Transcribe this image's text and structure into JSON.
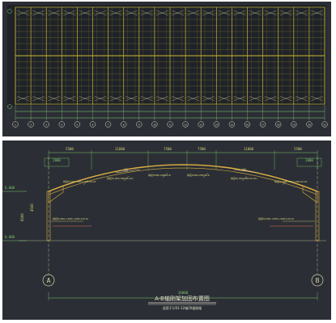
{
  "top_plan": {
    "bay_count": 20,
    "axis_count": 21,
    "grid_labels": [
      "1",
      "2",
      "3",
      "4",
      "5",
      "6",
      "7",
      "8",
      "9",
      "10",
      "11",
      "12",
      "13",
      "14",
      "15",
      "16",
      "17",
      "18",
      "19",
      "20",
      "21"
    ],
    "line_color": "#c8b432",
    "axis_color": "#8ad07a",
    "bg_color": "#1f2328"
  },
  "section": {
    "top_dimensions": [
      "5500",
      "11000",
      "7500",
      "7500",
      "11000",
      "5500"
    ],
    "span_dimension": "36000",
    "sub_dimensions": [
      "2000",
      "2000"
    ],
    "left_axis": "A",
    "right_axis": "B",
    "height_dims": [
      "6000",
      "4500"
    ],
    "elevations": [
      "6.000",
      "0.000"
    ],
    "slope_labels": [
      "10",
      "10"
    ],
    "beam_notes": [
      "焊接H(600~300)×300×8×10",
      "焊接H(300×300×8×10)",
      "焊接H300×200×6×8",
      "焊接H300×200×6×8",
      "焊接H(300×300×8×10)",
      "焊接H(600~300)×300×8×10"
    ],
    "column_notes": [
      "焊接H(600~1300)×400×10×16",
      "焊接H(600~1300)×400×10×16"
    ],
    "title": "A-B轴刚架加固布置图",
    "subtitle": "适用于1/01-12轴20榀刚架",
    "line_color": "#d6d0a4",
    "structure_color": "#e0b040",
    "dim_color": "#7ec86a",
    "note_color": "#d9d27a",
    "warn_color": "#e07050"
  }
}
